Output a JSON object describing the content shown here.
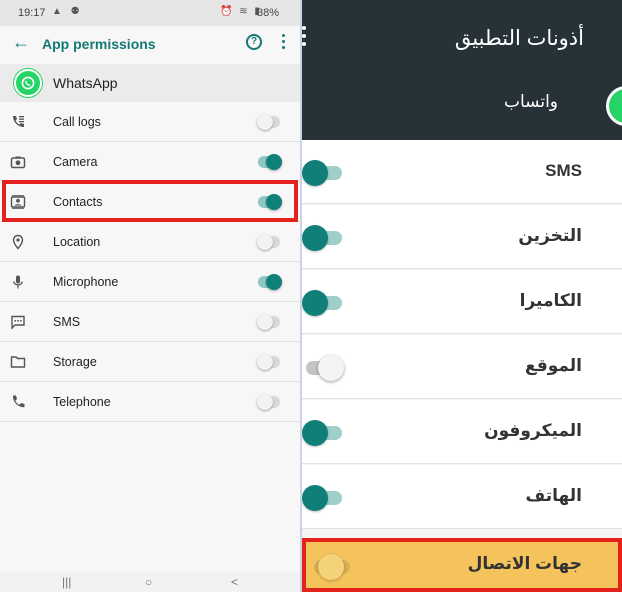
{
  "left": {
    "status_bar": {
      "time": "19:17",
      "battery": "38%"
    },
    "app_bar": {
      "title": "App permissions"
    },
    "app": {
      "name": "WhatsApp"
    },
    "permissions": [
      {
        "label": "Call logs",
        "icon": "call-log-icon",
        "enabled": false
      },
      {
        "label": "Camera",
        "icon": "camera-icon",
        "enabled": true
      },
      {
        "label": "Contacts",
        "icon": "contacts-icon",
        "enabled": true,
        "highlighted": true
      },
      {
        "label": "Location",
        "icon": "location-icon",
        "enabled": false
      },
      {
        "label": "Microphone",
        "icon": "microphone-icon",
        "enabled": true
      },
      {
        "label": "SMS",
        "icon": "sms-icon",
        "enabled": false
      },
      {
        "label": "Storage",
        "icon": "folder-icon",
        "enabled": false
      },
      {
        "label": "Telephone",
        "icon": "phone-icon",
        "enabled": false
      }
    ],
    "nav": {
      "recents": "|||",
      "home": "○",
      "back": "<"
    }
  },
  "right": {
    "title": "أذونات التطبيق",
    "app_name": "واتساب",
    "permissions": [
      {
        "label": "SMS",
        "enabled": true
      },
      {
        "label": "التخزين",
        "enabled": true
      },
      {
        "label": "الكاميرا",
        "enabled": true
      },
      {
        "label": "الموقع",
        "enabled": false
      },
      {
        "label": "الميكروفون",
        "enabled": true
      },
      {
        "label": "الهاتف",
        "enabled": true
      }
    ],
    "highlighted": {
      "label": "جهات الاتصال",
      "enabled": false
    }
  },
  "colors": {
    "accent": "#0f7f78",
    "highlight_border": "#e3231b",
    "highlight_fill": "#f5c35c",
    "whatsapp_green": "#25d366",
    "dark_header": "#263238"
  }
}
